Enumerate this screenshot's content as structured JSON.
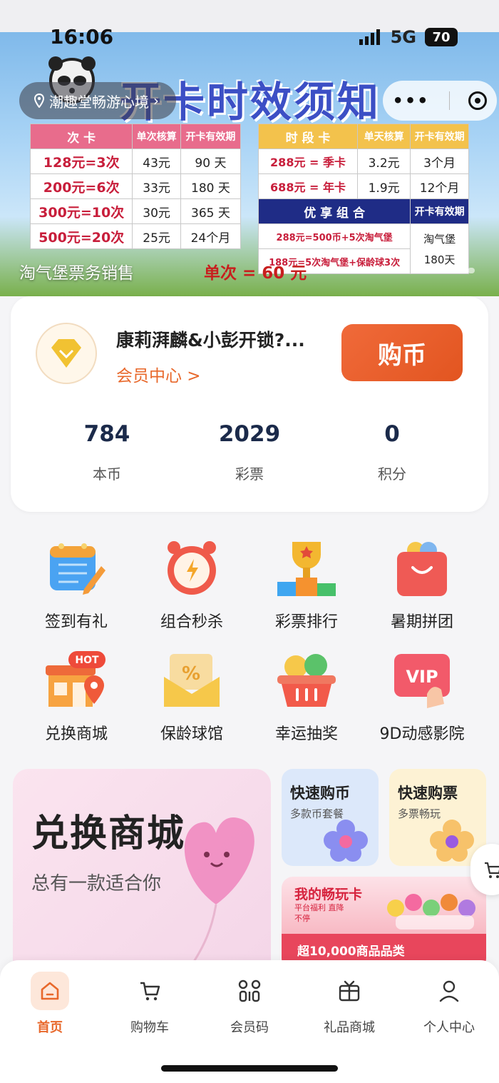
{
  "status_bar": {
    "time": "16:06",
    "network": "5G",
    "battery": "70"
  },
  "banner": {
    "title": "开卡时效须知",
    "location": "潮趣堂畅游心境",
    "caption": "淘气堡票务销售",
    "single_price": "单次 = 60 元",
    "left_table": {
      "headers": [
        "次 卡",
        "单次核算",
        "开卡有效期"
      ],
      "rows": [
        [
          "128元=3次",
          "43元",
          "90 天"
        ],
        [
          "200元=6次",
          "33元",
          "180 天"
        ],
        [
          "300元=10次",
          "30元",
          "365 天"
        ],
        [
          "500元=20次",
          "25元",
          "24个月"
        ]
      ]
    },
    "right_table": {
      "headers": [
        "时 段 卡",
        "单天核算",
        "开卡有效期"
      ],
      "rows": [
        [
          "288元 = 季卡",
          "3.2元",
          "3个月"
        ],
        [
          "688元 = 年卡",
          "1.9元",
          "12个月"
        ]
      ],
      "combo_header": [
        "优 享 组 合",
        "开卡有效期"
      ],
      "combo_rows": [
        "288元=500币+5次淘气堡",
        "188元=5次淘气堡+保龄球3次"
      ],
      "combo_validity": [
        "淘气堡",
        "180天"
      ]
    }
  },
  "member": {
    "name": "康莉湃麟&小彭开锁?...",
    "center_link": "会员中心 >",
    "buy_button": "购币",
    "stats": [
      {
        "value": "784",
        "label": "本币"
      },
      {
        "value": "2029",
        "label": "彩票"
      },
      {
        "value": "0",
        "label": "积分"
      }
    ]
  },
  "grid": [
    {
      "label": "签到有礼",
      "icon": "calendar-pen-icon"
    },
    {
      "label": "组合秒杀",
      "icon": "alarm-clock-icon"
    },
    {
      "label": "彩票排行",
      "icon": "trophy-podium-icon"
    },
    {
      "label": "暑期拼团",
      "icon": "shopping-bag-icon"
    },
    {
      "label": "兑换商城",
      "icon": "store-icon",
      "badge": "HOT"
    },
    {
      "label": "保龄球馆",
      "icon": "coupon-envelope-icon"
    },
    {
      "label": "幸运抽奖",
      "icon": "basket-icon"
    },
    {
      "label": "9D动感影院",
      "icon": "vip-card-icon",
      "badge_text": "VIP"
    }
  ],
  "promos": {
    "big": {
      "title": "兑换商城",
      "subtitle": "总有一款适合你"
    },
    "quick_buy": {
      "title": "快速购币",
      "subtitle": "多款币套餐"
    },
    "quick_ticket": {
      "title": "快速购票",
      "subtitle": "多票畅玩"
    },
    "card": {
      "title": "我的畅玩卡",
      "subtitle": "平台福利 直降不停",
      "strip": "超10,000商品品类"
    }
  },
  "tabbar": [
    {
      "label": "首页",
      "icon": "home-icon",
      "active": true
    },
    {
      "label": "购物车",
      "icon": "cart-icon"
    },
    {
      "label": "会员码",
      "icon": "grid-code-icon"
    },
    {
      "label": "礼品商城",
      "icon": "gift-icon"
    },
    {
      "label": "个人中心",
      "icon": "person-icon"
    }
  ],
  "colors": {
    "accent": "#e8682b",
    "stat_value": "#1b2a4a",
    "banner_title": "#3c4fc5"
  }
}
